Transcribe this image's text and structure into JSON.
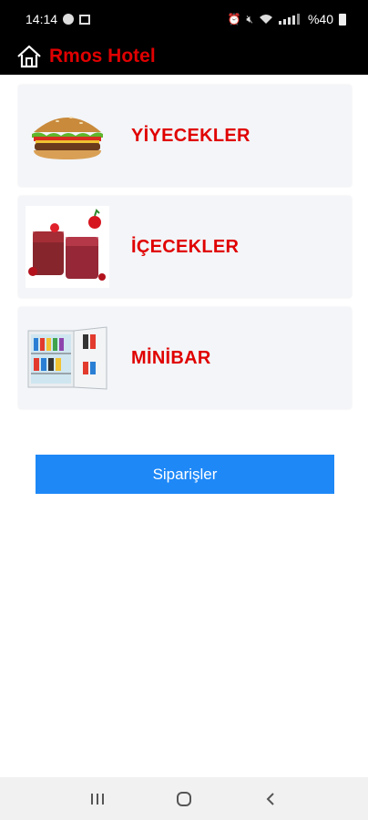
{
  "status_bar": {
    "time": "14:14",
    "battery": "%40"
  },
  "app_bar": {
    "title": "Rmos Hotel"
  },
  "categories": [
    {
      "label": "YİYECEKLER",
      "icon": "burger-image"
    },
    {
      "label": "İÇECEKLER",
      "icon": "drinks-image"
    },
    {
      "label": "MİNİBAR",
      "icon": "minibar-fridge-image"
    }
  ],
  "orders_button": {
    "label": "Siparişler"
  },
  "colors": {
    "title_red": "#e00000",
    "button_blue": "#1e88f7",
    "card_bg": "#f3f5f8"
  }
}
